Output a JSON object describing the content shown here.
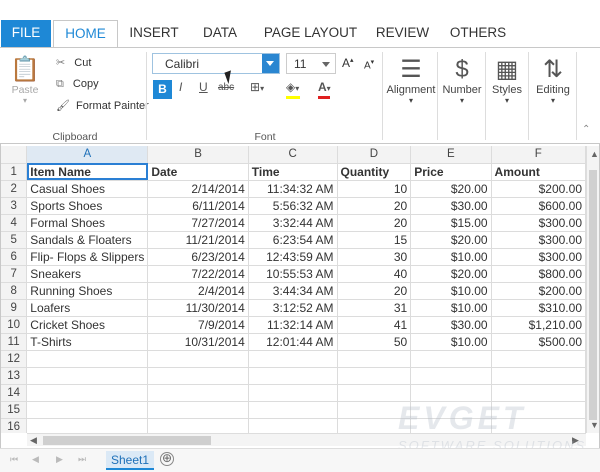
{
  "tabs": [
    {
      "label": "FILE"
    },
    {
      "label": "HOME"
    },
    {
      "label": "INSERT"
    },
    {
      "label": "DATA"
    },
    {
      "label": "PAGE LAYOUT"
    },
    {
      "label": "REVIEW"
    },
    {
      "label": "OTHERS"
    }
  ],
  "ribbon": {
    "clipboard": {
      "paste": "Paste",
      "cut": "Cut",
      "copy": "Copy",
      "format_painter": "Format Painter",
      "label": "Clipboard"
    },
    "font": {
      "family": "Calibri",
      "size": "11",
      "label": "Font",
      "bold": "B",
      "italic": "I",
      "underline": "U",
      "strike": "abc"
    },
    "alignment": "Alignment",
    "number": "Number",
    "styles": "Styles",
    "editing": "Editing"
  },
  "grid": {
    "columns": [
      "A",
      "B",
      "C",
      "D",
      "E",
      "F"
    ],
    "header_row": [
      "Item Name",
      "Date",
      "Time",
      "Quantity",
      "Price",
      "Amount"
    ],
    "rows": [
      [
        "Casual Shoes",
        "2/14/2014",
        "11:34:32 AM",
        "10",
        "$20.00",
        "$200.00"
      ],
      [
        "Sports Shoes",
        "6/11/2014",
        "5:56:32 AM",
        "20",
        "$30.00",
        "$600.00"
      ],
      [
        "Formal Shoes",
        "7/27/2014",
        "3:32:44 AM",
        "20",
        "$15.00",
        "$300.00"
      ],
      [
        "Sandals & Floaters",
        "11/21/2014",
        "6:23:54 AM",
        "15",
        "$20.00",
        "$300.00"
      ],
      [
        "Flip- Flops & Slippers",
        "6/23/2014",
        "12:43:59 AM",
        "30",
        "$10.00",
        "$300.00"
      ],
      [
        "Sneakers",
        "7/22/2014",
        "10:55:53 AM",
        "40",
        "$20.00",
        "$800.00"
      ],
      [
        "Running Shoes",
        "2/4/2014",
        "3:44:34 AM",
        "20",
        "$10.00",
        "$200.00"
      ],
      [
        "Loafers",
        "11/30/2014",
        "3:12:52 AM",
        "31",
        "$10.00",
        "$310.00"
      ],
      [
        "Cricket Shoes",
        "7/9/2014",
        "11:32:14 AM",
        "41",
        "$30.00",
        "$1,210.00"
      ],
      [
        "T-Shirts",
        "10/31/2014",
        "12:01:44 AM",
        "50",
        "$10.00",
        "$500.00"
      ]
    ],
    "row_numbers": [
      "1",
      "2",
      "3",
      "4",
      "5",
      "6",
      "7",
      "8",
      "9",
      "10",
      "11",
      "12",
      "13",
      "14",
      "15",
      "16"
    ]
  },
  "sheets": {
    "active": "Sheet1",
    "add": "⊕"
  },
  "watermark": {
    "brand": "EVGET",
    "tagline": "SOFTWARE SOLUTIONS"
  }
}
